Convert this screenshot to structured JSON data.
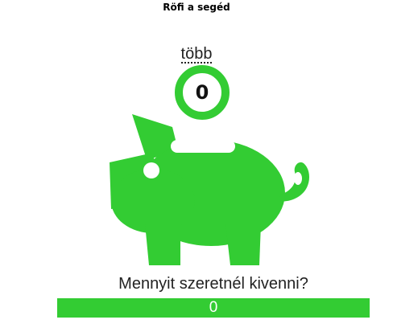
{
  "header": {
    "title": "Röfi a segéd"
  },
  "more_link": {
    "label": "több"
  },
  "coin": {
    "value": "0"
  },
  "pig": {
    "icon": "piggy-bank-icon",
    "color": "#33cc33"
  },
  "withdraw": {
    "question": "Mennyit szeretnél kivenni?",
    "value": "0"
  },
  "colors": {
    "accent": "#33cc33",
    "background": "#ffffff"
  }
}
